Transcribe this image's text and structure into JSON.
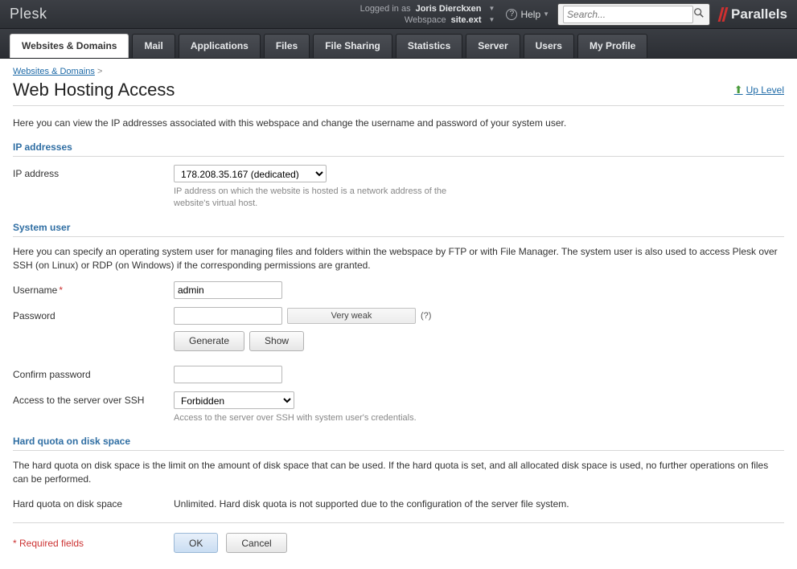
{
  "topbar": {
    "logo": "Plesk",
    "logged_in_label": "Logged in as",
    "user": "Joris Dierckxen",
    "webspace_label": "Webspace",
    "webspace": "site.ext",
    "help": "Help",
    "search_placeholder": "Search...",
    "brand": "Parallels"
  },
  "tabs": [
    "Websites & Domains",
    "Mail",
    "Applications",
    "Files",
    "File Sharing",
    "Statistics",
    "Server",
    "Users",
    "My Profile"
  ],
  "active_tab": 0,
  "breadcrumb": {
    "link": "Websites & Domains",
    "sep": ">"
  },
  "page_title": "Web Hosting Access",
  "up_level": "Up Level",
  "intro": "Here you can view the IP addresses associated with this webspace and change the username and password of your system user.",
  "ip_section": {
    "title": "IP addresses",
    "label": "IP address",
    "value": "178.208.35.167 (dedicated)",
    "hint": "IP address on which the website is hosted is a network address of the website's virtual host."
  },
  "sysuser_section": {
    "title": "System user",
    "desc": "Here you can specify an operating system user for managing files and folders within the webspace by FTP or with File Manager. The system user is also used to access Plesk over SSH (on Linux) or RDP (on Windows) if the corresponding permissions are granted.",
    "username_label": "Username",
    "username_value": "admin",
    "password_label": "Password",
    "password_value": "",
    "strength": "Very weak",
    "pw_help": "(?)",
    "generate": "Generate",
    "show": "Show",
    "confirm_label": "Confirm password",
    "confirm_value": "",
    "ssh_label": "Access to the server over SSH",
    "ssh_value": "Forbidden",
    "ssh_hint": "Access to the server over SSH with system user's credentials."
  },
  "quota_section": {
    "title": "Hard quota on disk space",
    "desc": "The hard quota on disk space is the limit on the amount of disk space that can be used. If the hard quota is set, and all allocated disk space is used, no further operations on files can be performed.",
    "label": "Hard quota on disk space",
    "value": "Unlimited. Hard disk quota is not supported due to the configuration of the server file system."
  },
  "footer": {
    "required": "* Required fields",
    "ok": "OK",
    "cancel": "Cancel"
  }
}
